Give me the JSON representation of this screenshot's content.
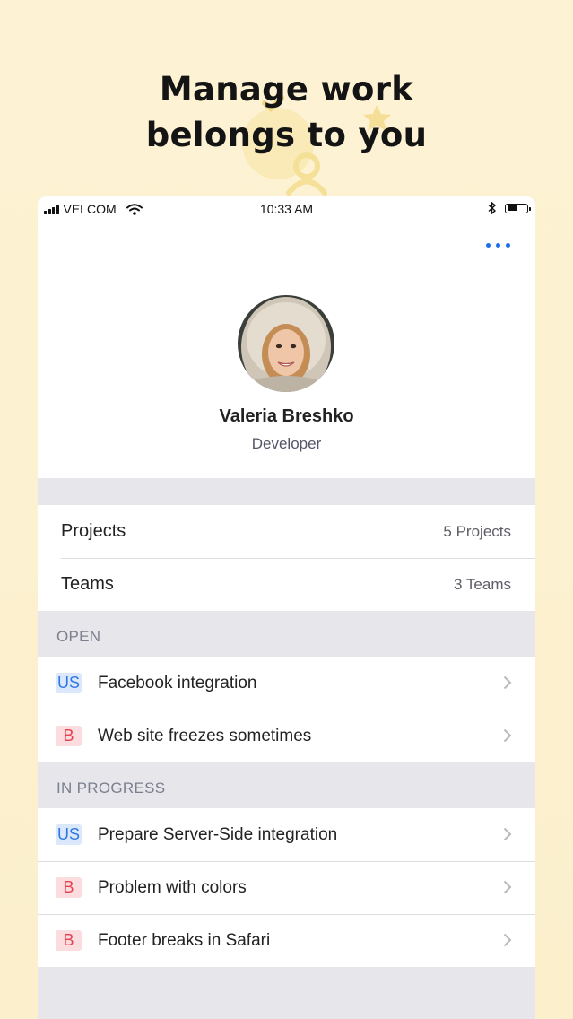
{
  "hero": {
    "title_line1": "Manage work",
    "title_line2": "belongs to you"
  },
  "status_bar": {
    "carrier": "VELCOM",
    "time": "10:33 AM",
    "battery_level": 0.55,
    "icons": [
      "signal-icon",
      "wifi-icon",
      "bluetooth-icon",
      "battery-icon"
    ]
  },
  "navbar": {
    "more_icon": "more-icon"
  },
  "profile": {
    "name": "Valeria Breshko",
    "role": "Developer"
  },
  "stats": [
    {
      "label": "Projects",
      "value": "5 Projects"
    },
    {
      "label": "Teams",
      "value": "3 Teams"
    }
  ],
  "sections": {
    "open": {
      "header": "OPEN",
      "items": [
        {
          "badge": "US",
          "title": "Facebook integration"
        },
        {
          "badge": "B",
          "title": "Web site freezes sometimes"
        }
      ]
    },
    "in_progress": {
      "header": "IN PROGRESS",
      "items": [
        {
          "badge": "US",
          "title": "Prepare Server-Side integration"
        },
        {
          "badge": "B",
          "title": "Problem with colors"
        },
        {
          "badge": "B",
          "title": "Footer breaks in Safari"
        }
      ]
    }
  },
  "colors": {
    "background": "#fdf3d4",
    "accent_blue": "#1e6ee8",
    "us_badge_bg": "#dbe8fb",
    "us_badge_text": "#2f78e3",
    "bug_badge_bg": "#fbdcdf",
    "bug_badge_text": "#e4414f",
    "group_gray": "#e6e6eb"
  }
}
